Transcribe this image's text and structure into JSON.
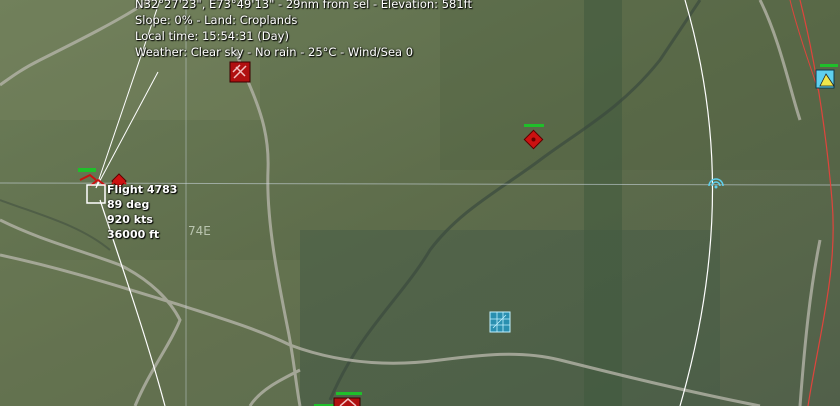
{
  "terrain_info": {
    "position_line": "N32°27'23\", E73°49'13\" - 29nm from sel - Elevation: 581ft",
    "slope_land_line": "Slope: 0%  - Land: Croplands",
    "local_time_line": "Local time: 15:54:31 (Day)",
    "weather_line": "Weather: Clear sky - No rain - 25°C - Wind/Sea 0"
  },
  "selected_track": {
    "name": "Flight 4783",
    "heading": "89 deg",
    "speed": "920 kts",
    "altitude": "36000 ft"
  },
  "grid": {
    "longitude_label": "74E"
  },
  "colors": {
    "hostile": "#cc1111",
    "friendly": "#5fd0ee",
    "range_ring": "#ffffff",
    "boundary": "#e0443c",
    "health_bar": "#1fbf2a"
  }
}
